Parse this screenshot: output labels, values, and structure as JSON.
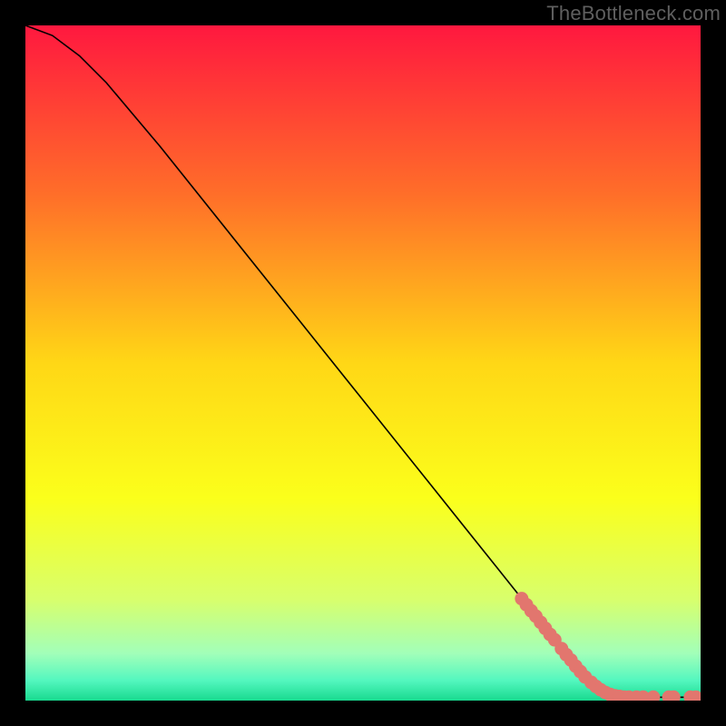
{
  "attribution": "TheBottleneck.com",
  "chart_data": {
    "type": "line",
    "title": "",
    "xlabel": "",
    "ylabel": "",
    "xlim": [
      0,
      100
    ],
    "ylim": [
      0,
      100
    ],
    "gradient_stops": [
      {
        "offset": 0.0,
        "color": "#ff183f"
      },
      {
        "offset": 0.25,
        "color": "#ff6e29"
      },
      {
        "offset": 0.5,
        "color": "#ffd716"
      },
      {
        "offset": 0.7,
        "color": "#fbff1b"
      },
      {
        "offset": 0.85,
        "color": "#d8ff6c"
      },
      {
        "offset": 0.93,
        "color": "#a2ffb9"
      },
      {
        "offset": 0.97,
        "color": "#54f7bf"
      },
      {
        "offset": 1.0,
        "color": "#18da8f"
      }
    ],
    "curve": [
      {
        "x": 0,
        "y": 100
      },
      {
        "x": 4,
        "y": 98.5
      },
      {
        "x": 8,
        "y": 95.5
      },
      {
        "x": 12,
        "y": 91.5
      },
      {
        "x": 20,
        "y": 82
      },
      {
        "x": 30,
        "y": 69.5
      },
      {
        "x": 40,
        "y": 57
      },
      {
        "x": 50,
        "y": 44.5
      },
      {
        "x": 60,
        "y": 32
      },
      {
        "x": 70,
        "y": 19.5
      },
      {
        "x": 78,
        "y": 9.5
      },
      {
        "x": 83,
        "y": 3.5
      },
      {
        "x": 86,
        "y": 1.2
      },
      {
        "x": 90,
        "y": 0.5
      },
      {
        "x": 95,
        "y": 0.5
      },
      {
        "x": 100,
        "y": 0.5
      }
    ],
    "highlight_points": [
      {
        "x": 73.5,
        "y": 15.1
      },
      {
        "x": 74.2,
        "y": 14.2
      },
      {
        "x": 74.9,
        "y": 13.3
      },
      {
        "x": 75.6,
        "y": 12.5
      },
      {
        "x": 76.3,
        "y": 11.6
      },
      {
        "x": 77.0,
        "y": 10.7
      },
      {
        "x": 77.7,
        "y": 9.8
      },
      {
        "x": 78.4,
        "y": 9.0
      },
      {
        "x": 79.4,
        "y": 7.7
      },
      {
        "x": 80.1,
        "y": 6.8
      },
      {
        "x": 80.8,
        "y": 6.0
      },
      {
        "x": 81.5,
        "y": 5.1
      },
      {
        "x": 82.2,
        "y": 4.3
      },
      {
        "x": 82.9,
        "y": 3.5
      },
      {
        "x": 83.8,
        "y": 2.7
      },
      {
        "x": 84.5,
        "y": 2.1
      },
      {
        "x": 85.2,
        "y": 1.6
      },
      {
        "x": 85.9,
        "y": 1.2
      },
      {
        "x": 86.6,
        "y": 0.9
      },
      {
        "x": 87.3,
        "y": 0.7
      },
      {
        "x": 88.0,
        "y": 0.6
      },
      {
        "x": 88.7,
        "y": 0.5
      },
      {
        "x": 89.4,
        "y": 0.5
      },
      {
        "x": 90.5,
        "y": 0.5
      },
      {
        "x": 91.5,
        "y": 0.5
      },
      {
        "x": 93.0,
        "y": 0.5
      },
      {
        "x": 95.3,
        "y": 0.5
      },
      {
        "x": 96.0,
        "y": 0.5
      },
      {
        "x": 98.5,
        "y": 0.5
      },
      {
        "x": 99.3,
        "y": 0.5
      }
    ],
    "highlight_color": "#e2766e",
    "curve_color": "#000000"
  }
}
